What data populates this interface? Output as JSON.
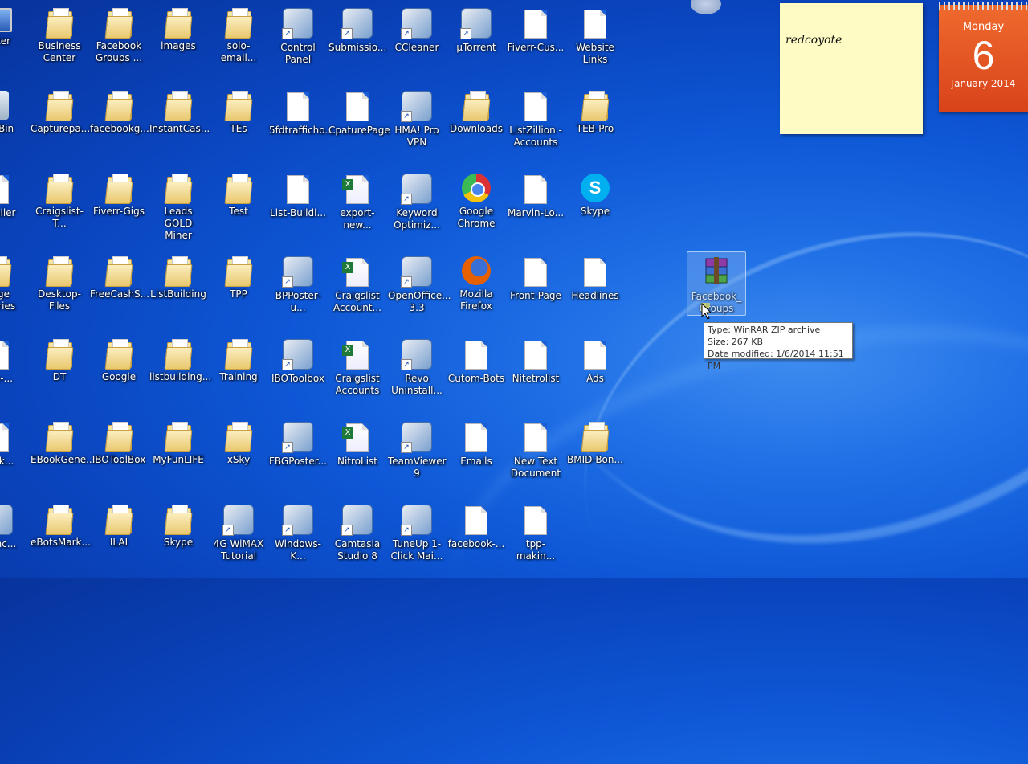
{
  "desktop": {
    "icons": [
      {
        "label": "puter",
        "type": "computer"
      },
      {
        "label": "Business Center",
        "type": "folder"
      },
      {
        "label": "Facebook Groups ...",
        "type": "folder"
      },
      {
        "label": "images",
        "type": "folder"
      },
      {
        "label": "solo-email...",
        "type": "folder"
      },
      {
        "label": "Control Panel",
        "type": "app"
      },
      {
        "label": "Submissio...",
        "type": "app"
      },
      {
        "label": "CCleaner",
        "type": "app"
      },
      {
        "label": "µTorrent",
        "type": "app"
      },
      {
        "label": "Fiverr-Cus...",
        "type": "doc"
      },
      {
        "label": "Website Links",
        "type": "doc"
      },
      {
        "label": "cle Bin",
        "type": "recycle"
      },
      {
        "label": "Capturepa...",
        "type": "folder"
      },
      {
        "label": "facebookg...",
        "type": "folder"
      },
      {
        "label": "InstantCas...",
        "type": "folder"
      },
      {
        "label": "TEs",
        "type": "folder"
      },
      {
        "label": "5fdtrafficho...",
        "type": "doc"
      },
      {
        "label": "CpaturePage",
        "type": "doc"
      },
      {
        "label": "HMA! Pro VPN",
        "type": "app"
      },
      {
        "label": "Downloads",
        "type": "folder"
      },
      {
        "label": "ListZillion - Accounts",
        "type": "doc"
      },
      {
        "label": "TEB-Pro",
        "type": "folder"
      },
      {
        "label": "kmailer",
        "type": "doc"
      },
      {
        "label": "Craigslist-T...",
        "type": "folder"
      },
      {
        "label": "Fiverr-Gigs",
        "type": "folder"
      },
      {
        "label": "Leads GOLD Miner",
        "type": "folder"
      },
      {
        "label": "Test",
        "type": "folder"
      },
      {
        "label": "List-Buildi...",
        "type": "doc"
      },
      {
        "label": "export-new...",
        "type": "excel"
      },
      {
        "label": "Keyword Optimiz...",
        "type": "app"
      },
      {
        "label": "Google Chrome",
        "type": "chrome"
      },
      {
        "label": "Marvin-Lo...",
        "type": "doc"
      },
      {
        "label": "Skype",
        "type": "skype"
      },
      {
        "label": "page egories",
        "type": "folder"
      },
      {
        "label": "Desktop-Files",
        "type": "folder"
      },
      {
        "label": "FreeCashS...",
        "type": "folder"
      },
      {
        "label": "ListBuilding",
        "type": "folder"
      },
      {
        "label": "TPP",
        "type": "folder"
      },
      {
        "label": "BPPoster-u...",
        "type": "app"
      },
      {
        "label": "Craigslist Account...",
        "type": "excel"
      },
      {
        "label": "OpenOffice... 3.3",
        "type": "app"
      },
      {
        "label": "Mozilla Firefox",
        "type": "firefox"
      },
      {
        "label": "Front-Page",
        "type": "doc"
      },
      {
        "label": "Headlines",
        "type": "doc"
      },
      {
        "label": "age-...",
        "type": "doc"
      },
      {
        "label": "DT",
        "type": "folder"
      },
      {
        "label": "Google",
        "type": "folder"
      },
      {
        "label": "listbuilding...",
        "type": "folder"
      },
      {
        "label": "Training",
        "type": "folder"
      },
      {
        "label": "IBOToolbox",
        "type": "app"
      },
      {
        "label": "Craigslist Accounts",
        "type": "excel"
      },
      {
        "label": "Revo Uninstall...",
        "type": "app"
      },
      {
        "label": "Cutom-Bots",
        "type": "doc"
      },
      {
        "label": "Nitetrolist",
        "type": "doc"
      },
      {
        "label": "Ads",
        "type": "doc"
      },
      {
        "label": "Back...",
        "type": "doc"
      },
      {
        "label": "EBookGene...",
        "type": "folder"
      },
      {
        "label": "IBOToolBox",
        "type": "folder"
      },
      {
        "label": "MyFunLIFE",
        "type": "folder"
      },
      {
        "label": "xSky",
        "type": "folder"
      },
      {
        "label": "FBGPoster...",
        "type": "app"
      },
      {
        "label": "NitroList",
        "type": "excel"
      },
      {
        "label": "TeamViewer 9",
        "type": "app"
      },
      {
        "label": "Emails",
        "type": "doc"
      },
      {
        "label": "New Text Document",
        "type": "doc"
      },
      {
        "label": "BMID-Bon...",
        "type": "folder"
      },
      {
        "label": "MyInc...",
        "type": "app"
      },
      {
        "label": "eBotsMark...",
        "type": "folder"
      },
      {
        "label": "ILAI",
        "type": "folder"
      },
      {
        "label": "Skype",
        "type": "folder"
      },
      {
        "label": "4G WiMAX Tutorial",
        "type": "app"
      },
      {
        "label": "Windows-K...",
        "type": "app"
      },
      {
        "label": "Camtasia Studio 8",
        "type": "app"
      },
      {
        "label": "TuneUp 1-Click Mai...",
        "type": "app"
      },
      {
        "label": "facebook-...",
        "type": "doc"
      },
      {
        "label": "tpp-makin...",
        "type": "doc"
      }
    ],
    "selected_file": {
      "label": "Facebook_Groups",
      "type": "winrar"
    }
  },
  "sticky_note": {
    "text": "redcoyote"
  },
  "calendar": {
    "day_of_week": "Monday",
    "day": "6",
    "month_year": "January 2014"
  },
  "tooltip": {
    "type_line": "Type: WinRAR ZIP archive",
    "size_line": "Size: 267 KB",
    "date_line": "Date modified: 1/6/2014 11:51 PM"
  }
}
